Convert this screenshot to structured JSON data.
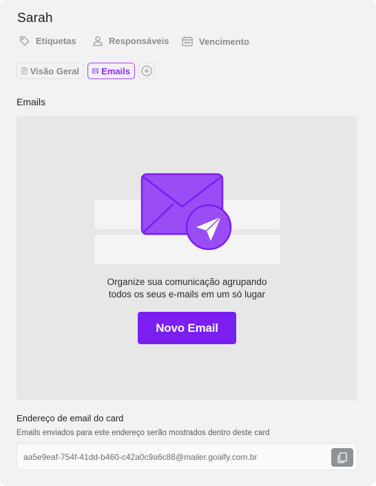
{
  "card": {
    "title": "Sarah"
  },
  "meta": {
    "tags_label": "Etiquetas",
    "assignees_label": "Responsáveis",
    "due_label": "Vencimento"
  },
  "tabs": [
    {
      "label": "Visão Geral",
      "icon": "document-icon",
      "active": false
    },
    {
      "label": "Emails",
      "icon": "envelope-icon",
      "active": true
    }
  ],
  "emails_section": {
    "title": "Emails",
    "empty_text_line1": "Organize sua comunicação agrupando",
    "empty_text_line2": "todos os seus e-mails em um só lugar",
    "new_email_button": "Novo Email"
  },
  "address": {
    "title": "Endereço de email do card",
    "description": "Emails enviados para este endereço serão mostrados dentro deste card",
    "value": "aa5e9eaf-754f-41dd-b460-c42a0c9a6c88@mailer.goalfy.com.br"
  },
  "colors": {
    "accent": "#7a1ff0",
    "illustration_purple": "#9a4cf5",
    "background": "#f2f2f2"
  }
}
